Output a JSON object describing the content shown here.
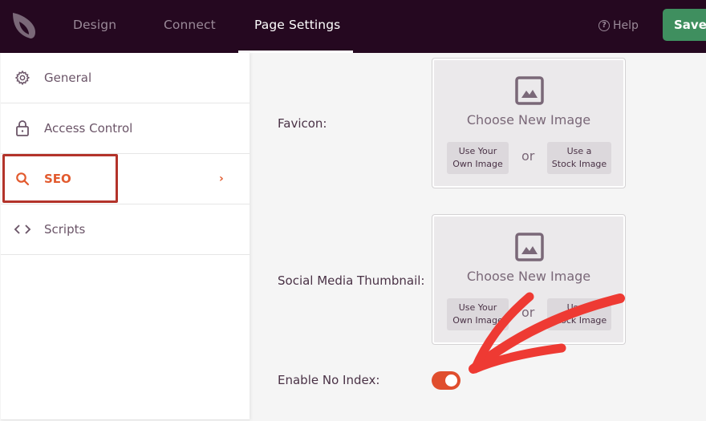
{
  "topbar": {
    "logo": "seedprod-leaf-icon",
    "tabs": [
      {
        "label": "Design",
        "active": false
      },
      {
        "label": "Connect",
        "active": false
      },
      {
        "label": "Page Settings",
        "active": true
      }
    ],
    "help_label": "Help",
    "help_icon": "question-circle-icon",
    "save_label": "Save",
    "colors": {
      "background": "#250820",
      "save": "#3f8f5f"
    }
  },
  "sidebar": {
    "items": [
      {
        "label": "General",
        "icon": "gear-icon",
        "active": false
      },
      {
        "label": "Access Control",
        "icon": "lock-icon",
        "active": false
      },
      {
        "label": "SEO",
        "icon": "search-icon",
        "active": true,
        "chevron": "›"
      },
      {
        "label": "Scripts",
        "icon": "code-icon",
        "active": false
      }
    ],
    "active_color": "#e25a2e",
    "highlight_color": "#b3332a"
  },
  "main": {
    "favicon": {
      "label": "Favicon:",
      "choose_label": "Choose New Image",
      "own_image_label_1": "Use Your",
      "own_image_label_2": "Own Image",
      "or_label": "or",
      "stock_image_label_1": "Use a",
      "stock_image_label_2": "Stock Image"
    },
    "social_thumbnail": {
      "label": "Social Media Thumbnail:",
      "choose_label": "Choose New Image",
      "own_image_label_1": "Use Your",
      "own_image_label_2": "Own Image",
      "or_label": "or",
      "stock_image_label_1": "Use a",
      "stock_image_label_2": "Stock Image"
    },
    "no_index": {
      "label": "Enable No Index:",
      "enabled": true,
      "toggle_color": "#e04e2e"
    }
  },
  "annotation": {
    "arrow_color": "#ee3a33",
    "target": "no-index-toggle"
  }
}
